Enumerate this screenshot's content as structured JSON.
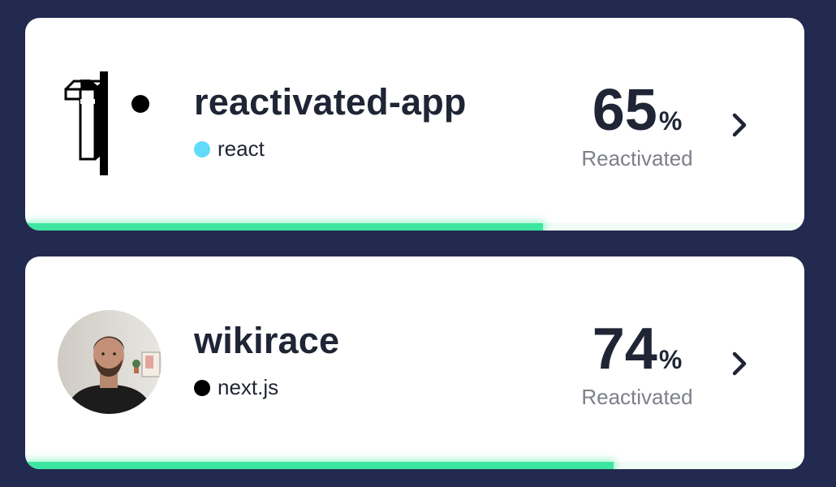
{
  "colors": {
    "background": "#232a50",
    "card": "#ffffff",
    "progress": "#3de6a0",
    "text": "#1f2535",
    "muted": "#7d8089"
  },
  "projects": [
    {
      "name": "reactivated-app",
      "avatar": "reactivated-logo-icon",
      "framework": {
        "label": "react",
        "color": "#61dafb"
      },
      "percent": "65",
      "percent_sign": "%",
      "status_label": "Reactivated",
      "progress": 0.665,
      "chevron": "chevron-right-icon"
    },
    {
      "name": "wikirace",
      "avatar": "user-avatar-photo",
      "framework": {
        "label": "next.js",
        "color": "#000000"
      },
      "percent": "74",
      "percent_sign": "%",
      "status_label": "Reactivated",
      "progress": 0.755,
      "chevron": "chevron-right-icon"
    }
  ]
}
